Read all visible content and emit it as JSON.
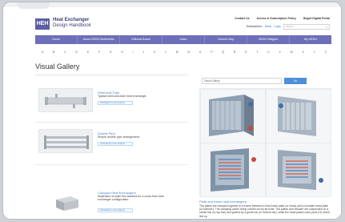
{
  "header": {
    "logo_text": "HEH",
    "title": "Heat Exchanger",
    "subtitle": "Design Handbook",
    "links": [
      "Contact Us",
      "Access & Subscription Policy",
      "Begell Digital Portal"
    ],
    "subscription_label": "Subscription:",
    "subscription_link": "Basic",
    "login_link": "Login",
    "search_placeholder": "Search"
  },
  "nav": [
    "Home",
    "About HEDH Multimedia",
    "Editorial Board",
    "Index",
    "Content Map",
    "HEDH Widgets",
    "My HEDH"
  ],
  "alphabet": [
    "A",
    "B",
    "C",
    "D",
    "E",
    "F",
    "G",
    "H",
    "I",
    "J",
    "K",
    "L",
    "M",
    "N",
    "O",
    "P",
    "Q",
    "R",
    "S",
    "T",
    "U",
    "V",
    "W",
    "X",
    "Y",
    "Z"
  ],
  "page_title": "Visual Gallery",
  "items": [
    {
      "title": "Shell-and-Tube",
      "desc": "Typical shell-and-tube heat exchanger.",
      "button": "Animated in new window"
    },
    {
      "title": "Double Pipe",
      "desc": "Simple double pipe arrangement.",
      "button": "Animated in new window"
    },
    {
      "title": "Compact Heat Exchangers",
      "desc": "Illustration of plate fins stacked for a cross-flow heat exchanger configuration.",
      "button": "Animated in new window"
    }
  ],
  "right": {
    "search_value": "Visual Gallery",
    "go_label": "Go",
    "caption_title": "Plate and frame heat exchangers",
    "caption_text": "The plates are clamped together in a frame between a fixed head plate (or head) and a movable head plate (or follower). The clamping action being carried out by tie bolts. The plates and follower are suspended on a carrier bar (or top bar) and guided by a guide bar (or bottom bar), while the head plates carry ports (O) which line up"
  },
  "colors": {
    "nav": "#6d6fb8",
    "logo": "#5b5fa4",
    "link": "#3b7fd0",
    "go_button": "#4f8fd8"
  }
}
